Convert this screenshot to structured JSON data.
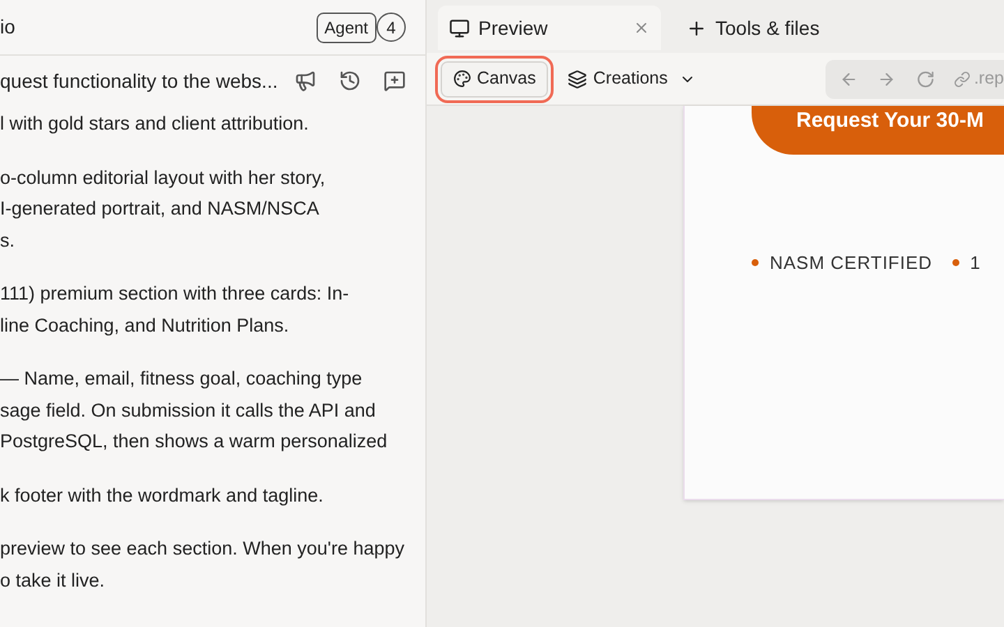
{
  "chat": {
    "title": "io",
    "mode_badge": "Agent",
    "count_badge": "4",
    "thread_title": "quest functionality to the webs...",
    "paragraphs": [
      [
        "l with gold stars and client attribution."
      ],
      [
        "o-column editorial layout with her story,",
        "I-generated portrait, and NASM/NSCA",
        "s."
      ],
      [
        "111) premium section with three cards: In-",
        "line Coaching, and Nutrition Plans."
      ],
      [
        "— Name, email, fitness goal, coaching type",
        "sage field. On submission it calls the API and",
        "PostgreSQL, then shows a warm personalized"
      ],
      [
        "k footer with the wordmark and tagline."
      ],
      [
        "preview to see each section. When you're happy",
        "o take it live."
      ]
    ]
  },
  "tabs": [
    {
      "label": "Preview",
      "selected": true
    },
    {
      "label": "Tools & files",
      "selected": false
    }
  ],
  "toolbar": {
    "canvas": {
      "label": "Canvas",
      "highlighted": true
    },
    "creations": {
      "label": "Creations"
    },
    "url": ".rep"
  },
  "preview": {
    "cta": "Request Your 30-M",
    "badges": [
      "NASM CERTIFIED",
      "1"
    ]
  }
}
